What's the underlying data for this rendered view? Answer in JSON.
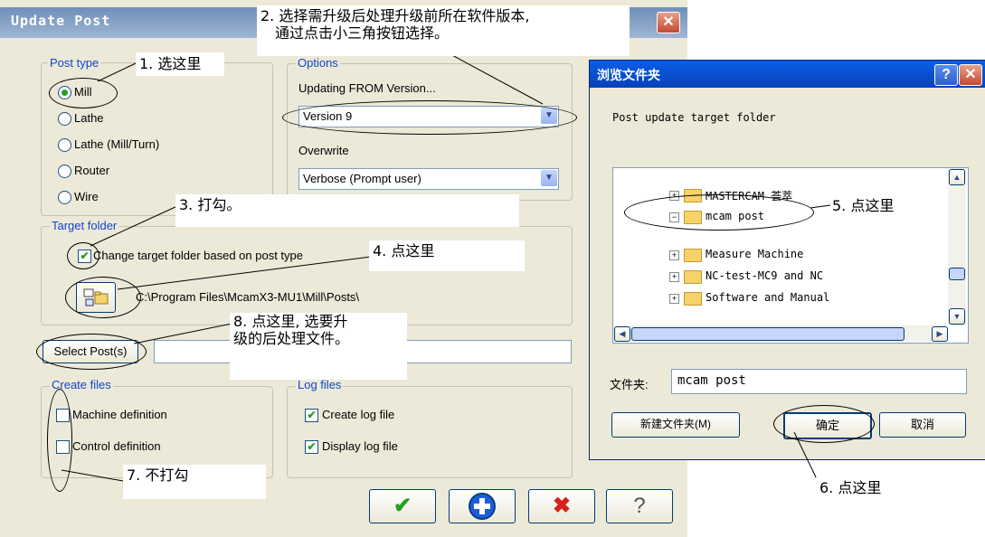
{
  "update_post": {
    "title": "Update Post",
    "post_type": {
      "label": "Post type",
      "options": [
        "Mill",
        "Lathe",
        "Lathe (Mill/Turn)",
        "Router",
        "Wire"
      ],
      "selected": "Mill"
    },
    "options_group": {
      "label": "Options",
      "updating_from_label": "Updating FROM Version...",
      "updating_from_value": "Version 9",
      "overwrite_label": "Overwrite",
      "overwrite_value": "Verbose (Prompt user)"
    },
    "target_folder": {
      "label": "Target folder",
      "checkbox_label": "Change target folder based on post type",
      "checked": true,
      "path": "C:\\Program Files\\McamX3-MU1\\Mill\\Posts\\"
    },
    "select_posts_label": "Select Post(s)",
    "create_files": {
      "label": "Create files",
      "items": [
        {
          "label": "Machine definition",
          "checked": false
        },
        {
          "label": "Control definition",
          "checked": false
        }
      ]
    },
    "log_files": {
      "label": "Log files",
      "items": [
        {
          "label": "Create log file",
          "checked": true
        },
        {
          "label": "Display log file",
          "checked": true
        }
      ]
    }
  },
  "browse_folder": {
    "title": "浏览文件夹",
    "help_symbol": "?",
    "close_symbol": "✕",
    "prompt": "Post update target folder",
    "tree_items": [
      {
        "label": "MASTERCAM 荟萃",
        "expander": "+"
      },
      {
        "label": "mcam post",
        "expander": "−"
      },
      {
        "label": "Measure Machine",
        "expander": "+"
      },
      {
        "label": "NC-test-MC9 and NC",
        "expander": "+"
      },
      {
        "label": "Software and Manual",
        "expander": "+"
      }
    ],
    "folder_label": "文件夹:",
    "folder_value": "mcam post",
    "new_folder_button": "新建文件夹(M)",
    "ok_button": "确定",
    "cancel_button": "取消"
  },
  "annotations": {
    "step1": "1. 选这里",
    "step2_line1": "2. 选择需升级后处理升级前所在软件版本,",
    "step2_line2": "通过点击小三角按钮选择。",
    "step3": "3. 打勾。",
    "step4": "4. 点这里",
    "step5": "5. 点这里",
    "step6": "6. 点这里",
    "step7": "7. 不打勾",
    "step8_line1": "8. 点这里, 选要升",
    "step8_line2": "级的后处理文件。"
  },
  "colors": {
    "group_label": "#1144cc",
    "check_green": "#21a121",
    "xp_title_blue": "#0a5ee8",
    "close_red": "#c24a30"
  }
}
